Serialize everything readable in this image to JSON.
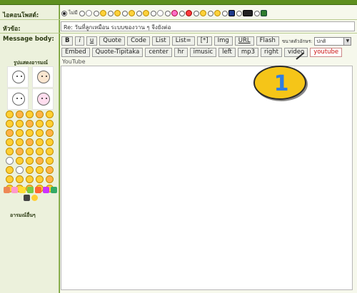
{
  "labels": {
    "icon": "ไอคอนโพสต์:",
    "subject": "หัวข้อ:",
    "message": "Message body:"
  },
  "post_icons": [
    {
      "name": "radio-selected",
      "text": "ไม่มี"
    },
    {
      "name": "smile-white"
    },
    {
      "name": "smile-yellow"
    },
    {
      "name": "smile-yellow"
    },
    {
      "name": "smile-yellow"
    },
    {
      "name": "smile-yellow"
    },
    {
      "name": "smile-white"
    },
    {
      "name": "flower-pink"
    },
    {
      "name": "flower-red"
    },
    {
      "name": "smile-yellow"
    },
    {
      "name": "smile-yellow"
    },
    {
      "name": "smile-blue"
    },
    {
      "name": "smile-black"
    },
    {
      "name": "smile-green"
    }
  ],
  "subject": {
    "value": "Re: วันที่ลูกเหมือน ระบบของวาน ๆ จีงยังต่อ"
  },
  "toolbar_row1": [
    "B",
    "i",
    "u",
    "Quote",
    "Code",
    "List",
    "List=",
    "[*]",
    "Img",
    "URL",
    "Flash"
  ],
  "font_size": {
    "label": "ขนาดตัวอักษร:",
    "selected": "ปกติ"
  },
  "toolbar_row2": [
    "Embed",
    "Quote-Tipitaka",
    "center",
    "hr",
    "imusic",
    "left",
    "mp3",
    "right",
    "video",
    "youtube"
  ],
  "hint_text": "YouTube",
  "sidebar": {
    "title": "รูปแสดงอารมณ์",
    "more": "อารมณ์อื่นๆ"
  },
  "annotation": {
    "number": "1"
  },
  "colors": {
    "accent_green": "#6d9b2b",
    "callout_yellow": "#f5c518",
    "callout_number": "#2f7de1",
    "youtube_text": "#c11"
  }
}
